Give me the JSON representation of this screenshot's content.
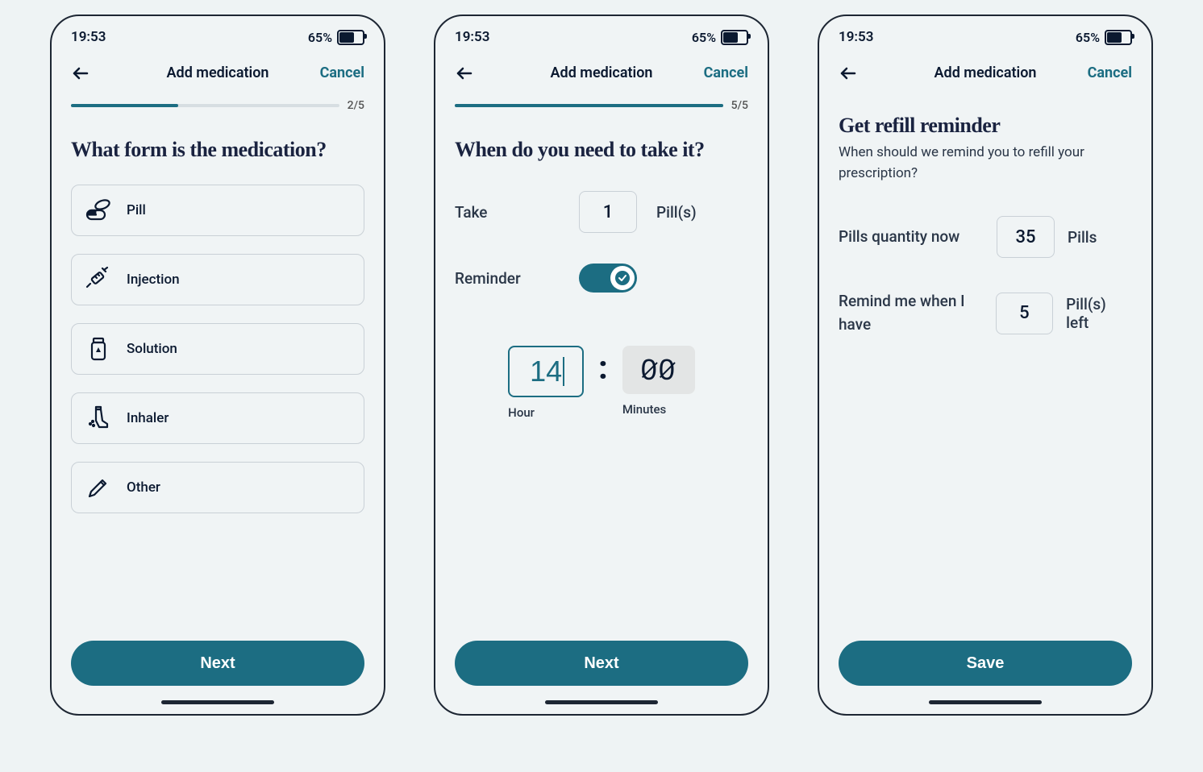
{
  "status": {
    "time": "19:53",
    "battery_text": "65%"
  },
  "nav": {
    "title": "Add medication",
    "cancel": "Cancel"
  },
  "screen1": {
    "step": "2/5",
    "heading": "What form is the medication?",
    "options": {
      "pill": "Pill",
      "injection": "Injection",
      "solution": "Solution",
      "inhaler": "Inhaler",
      "other": "Other"
    },
    "cta": "Next"
  },
  "screen2": {
    "step": "5/5",
    "heading": "When do you need to take it?",
    "take_label": "Take",
    "take_value": "1",
    "take_unit": "Pill(s)",
    "reminder_label": "Reminder",
    "hour_value": "14",
    "hour_label": "Hour",
    "min_value_a": "0",
    "min_value_b": "0",
    "min_label": "Minutes",
    "cta": "Next"
  },
  "screen3": {
    "heading": "Get refill reminder",
    "subtext": "When should we remind you to refill your prescription?",
    "qty_label": "Pills quantity now",
    "qty_value": "35",
    "qty_unit": "Pills",
    "remind_label": "Remind me when I have",
    "remind_value": "5",
    "remind_unit": "Pill(s) left",
    "cta": "Save"
  }
}
